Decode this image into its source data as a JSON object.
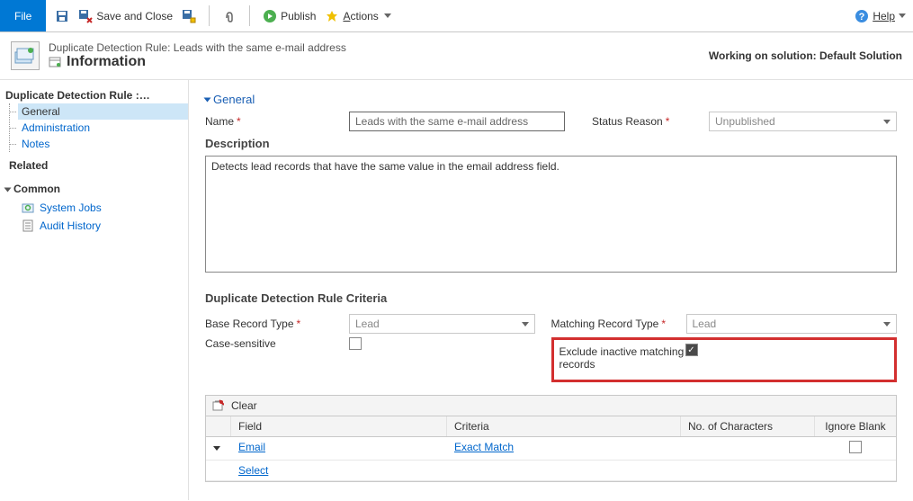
{
  "toolbar": {
    "file": "File",
    "save_close": "Save and Close",
    "publish": "Publish",
    "actions": "Actions",
    "help": "Help"
  },
  "header": {
    "subtitle": "Duplicate Detection Rule: Leads with the same e-mail address",
    "title": "Information",
    "solution_label": "Working on solution: Default Solution"
  },
  "sidebar": {
    "title_trunc": "Duplicate Detection Rule :…",
    "items": [
      "General",
      "Administration",
      "Notes"
    ],
    "related": "Related",
    "common": "Common",
    "common_items": [
      "System Jobs",
      "Audit History"
    ]
  },
  "form": {
    "section_general": "General",
    "name_label": "Name",
    "name_value": "Leads with the same e-mail address",
    "status_label": "Status Reason",
    "status_value": "Unpublished",
    "desc_label": "Description",
    "desc_value": "Detects lead records that have the same value in the email address field.",
    "criteria_head": "Duplicate Detection Rule Criteria",
    "base_type_label": "Base Record Type",
    "base_type_value": "Lead",
    "match_type_label": "Matching Record Type",
    "match_type_value": "Lead",
    "case_label": "Case-sensitive",
    "exclude_label": "Exclude inactive matching records",
    "clear_label": "Clear",
    "table_cols": {
      "field": "Field",
      "criteria": "Criteria",
      "chars": "No. of Characters",
      "blank": "Ignore Blank"
    },
    "rows": [
      {
        "field": "Email",
        "criteria": "Exact Match",
        "chars": "",
        "blank": false
      },
      {
        "field": "Select",
        "criteria": "",
        "chars": "",
        "blank": null
      }
    ]
  }
}
